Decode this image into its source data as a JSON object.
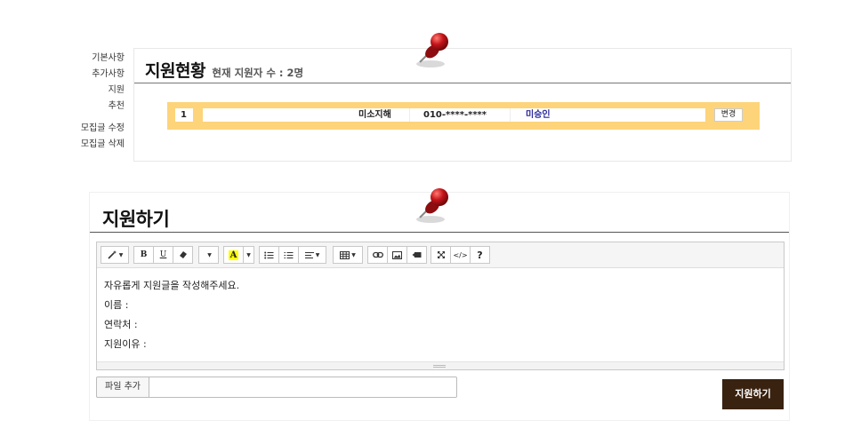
{
  "side_menu": {
    "items": [
      "기본사항",
      "추가사항",
      "지원",
      "추천",
      "모집글 수정",
      "모집글 삭제"
    ]
  },
  "status_panel": {
    "title": "지원현황",
    "count_text": "현재 지원자 수 : 2명",
    "applicant": {
      "number": "1",
      "name": "미소지해",
      "phone": "010-****-****",
      "status": "미승인",
      "change_label": "변경"
    }
  },
  "apply_panel": {
    "title": "지원하기",
    "toolbar": {
      "buttons": [
        "magic-icon",
        "bold-icon",
        "underline-icon",
        "eraser-icon",
        "font-dropdown",
        "highlight-icon",
        "color-dropdown",
        "unordered-list-icon",
        "ordered-list-icon",
        "align-icon",
        "table-icon",
        "link-icon",
        "image-icon",
        "video-icon",
        "fullscreen-icon",
        "code-view-icon",
        "help-icon"
      ],
      "bold_label": "B",
      "underline_label": "U",
      "highlight_label": "A",
      "help_label": "?"
    },
    "editor": {
      "intro": "자유롭게 지원글을 작성해주세요.",
      "name_label": "이름 :",
      "contact_label": "연락처 :",
      "reason_label": "지원이유 :"
    },
    "file_button_label": "파일 추가",
    "submit_label": "지원하기"
  },
  "colors": {
    "applicant_bar": "#fdd47a",
    "submit_bg": "#3a2210",
    "status_text": "#2a2a9a",
    "pin": "#c4141a"
  }
}
